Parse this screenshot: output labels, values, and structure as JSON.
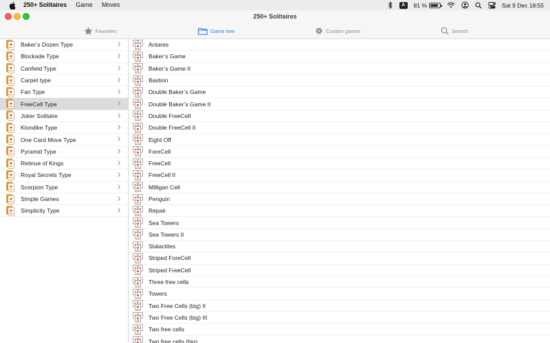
{
  "menubar": {
    "app_name": "250+ Solitaires",
    "menus": [
      "Game",
      "Moves"
    ],
    "status": {
      "keyboard_badge": "A",
      "battery_percent": "81 %",
      "battery_level": 0.81,
      "datetime": "Sat 9 Dec  18:55",
      "icons": [
        "bluetooth-icon",
        "wifi-icon",
        "user-icon",
        "spotlight-search-icon",
        "control-center-icon"
      ]
    }
  },
  "window": {
    "title": "250+ Solitaires"
  },
  "toolbar": {
    "tabs": [
      {
        "label": "Favorites",
        "icon": "star-icon",
        "active": false
      },
      {
        "label": "Game tree",
        "icon": "folder-icon",
        "active": true
      },
      {
        "label": "Custom games",
        "icon": "gear-icon",
        "active": false
      },
      {
        "label": "Search",
        "icon": "magnifier-icon",
        "active": false
      }
    ]
  },
  "categories": [
    {
      "label": "Baker’s Dozen Type"
    },
    {
      "label": "Blockade Type"
    },
    {
      "label": "Canfield Type"
    },
    {
      "label": "Carpet type"
    },
    {
      "label": "Fan Type"
    },
    {
      "label": "FreeCell Type",
      "selected": true
    },
    {
      "label": "Joker Solitaire"
    },
    {
      "label": "Klondike Type"
    },
    {
      "label": "One Card Move Type"
    },
    {
      "label": "Pyramid Type"
    },
    {
      "label": "Retinue of Kings"
    },
    {
      "label": "Royal Secrets Type"
    },
    {
      "label": "Scorpion Type"
    },
    {
      "label": "Simple Games"
    },
    {
      "label": "Simplicity Type"
    }
  ],
  "games": [
    {
      "label": "Antares"
    },
    {
      "label": "Baker’s Game"
    },
    {
      "label": "Baker’s Game II"
    },
    {
      "label": "Bastion"
    },
    {
      "label": "Double Baker’s Game"
    },
    {
      "label": "Double Baker’s Game II"
    },
    {
      "label": "Double FreeCell"
    },
    {
      "label": "Double FreeCell II"
    },
    {
      "label": "Eight Off"
    },
    {
      "label": "ForeCell"
    },
    {
      "label": "FreeCell"
    },
    {
      "label": "FreeCell II"
    },
    {
      "label": "Milligan Cell"
    },
    {
      "label": "Penguin"
    },
    {
      "label": "Repair"
    },
    {
      "label": "Sea Towers"
    },
    {
      "label": "Sea Towers II"
    },
    {
      "label": "Stalactites"
    },
    {
      "label": "Striped ForeCell"
    },
    {
      "label": "Striped FreeCell"
    },
    {
      "label": "Three free cells"
    },
    {
      "label": "Towers"
    },
    {
      "label": "Two Free Cells (big) II"
    },
    {
      "label": "Two Free Cells (big) III"
    },
    {
      "label": "Two free cells"
    },
    {
      "label": "Two free cells (big)"
    }
  ],
  "colors": {
    "accent": "#2f7bf6",
    "selected_row": "#dcdcdc",
    "card_red": "#d93a2b",
    "card_gold": "#e8a52a"
  }
}
